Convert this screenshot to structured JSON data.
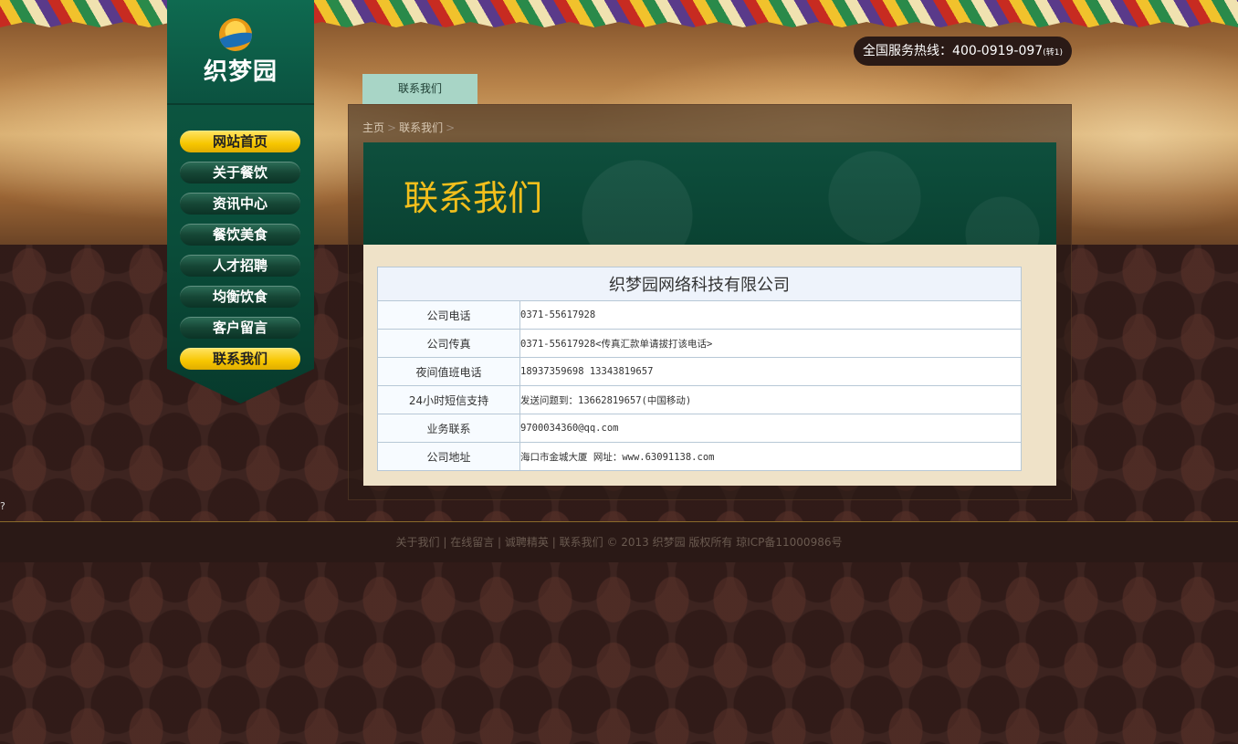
{
  "site": {
    "logo_text": "织梦园",
    "hotline": "全国服务热线：400-0919-097",
    "hotline_ext": "(转1)"
  },
  "nav": {
    "items": [
      {
        "label": "网站首页",
        "active": true
      },
      {
        "label": "关于餐饮",
        "active": false
      },
      {
        "label": "资讯中心",
        "active": false
      },
      {
        "label": "餐饮美食",
        "active": false
      },
      {
        "label": "人才招聘",
        "active": false
      },
      {
        "label": "均衡饮食",
        "active": false
      },
      {
        "label": "客户留言",
        "active": false
      },
      {
        "label": "联系我们",
        "active": true
      }
    ]
  },
  "page": {
    "tab_label": "联系我们",
    "breadcrumb": [
      "主页",
      "联系我们"
    ],
    "banner_title": "联系我们"
  },
  "contact": {
    "company": "织梦园网络科技有限公司",
    "rows": [
      {
        "label": "公司电话",
        "value": "0371-55617928"
      },
      {
        "label": "公司传真",
        "value": "0371-55617928<传真汇款单请拔打该电话>"
      },
      {
        "label": "夜间值班电话",
        "value": "18937359698 13343819657"
      },
      {
        "label": "24小时短信支持",
        "value": "发送问题到：13662819657(中国移动)"
      },
      {
        "label": "业务联系",
        "value": "9700034360@qq.com"
      },
      {
        "label": "公司地址",
        "value": "海口市金城大厦    网址：www.63091138.com"
      }
    ]
  },
  "stray_char": "?",
  "footer": {
    "links": [
      "关于我们",
      "在线留言",
      "诚聘精英",
      "联系我们"
    ],
    "copyright": "© 2013 织梦园 版权所有 琼ICP备11000986号"
  }
}
